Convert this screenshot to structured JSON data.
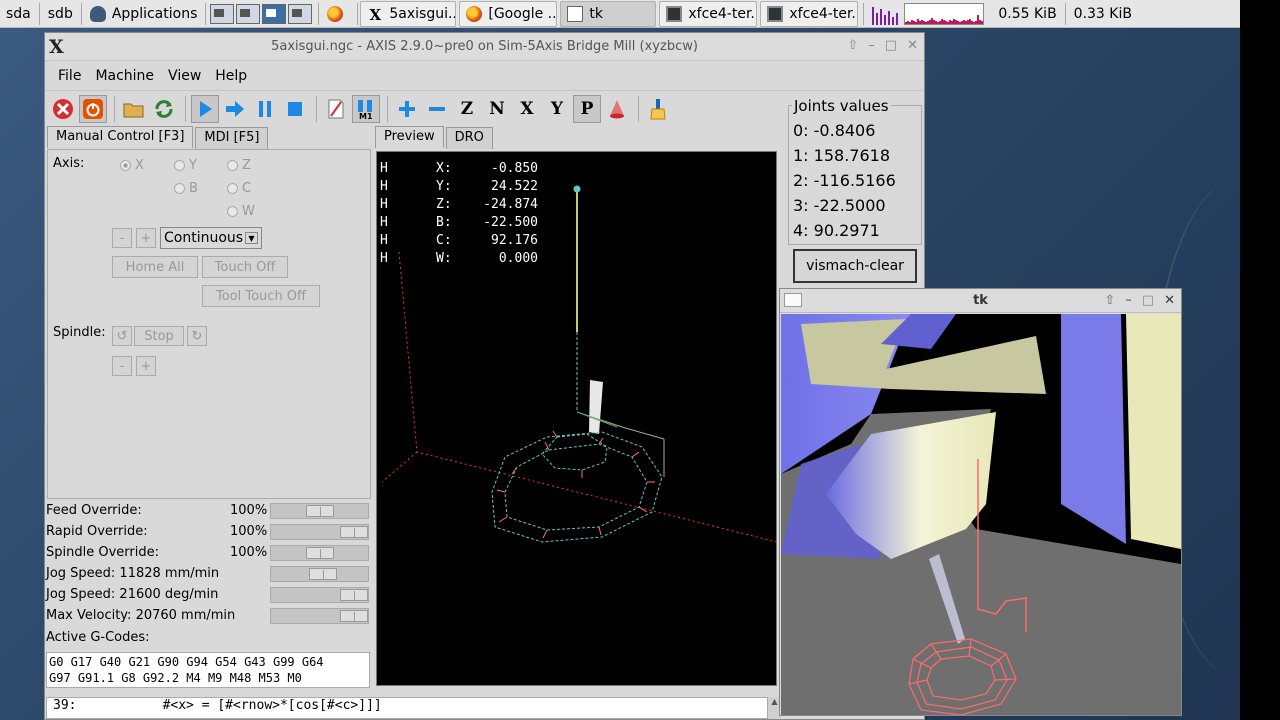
{
  "taskbar": {
    "drives": [
      "sda",
      "sdb"
    ],
    "apps_label": "Applications",
    "windows": [
      {
        "label": "5axisgui....",
        "icon": "x-icon"
      },
      {
        "label": "[Google ...",
        "icon": "firefox-icon"
      },
      {
        "label": "tk",
        "icon": "tk-icon"
      },
      {
        "label": "xfce4-ter...",
        "icon": "terminal-icon"
      },
      {
        "label": "xfce4-ter...",
        "icon": "terminal-icon"
      }
    ],
    "net_down": "0.55 KiB",
    "net_up": "0.33 KiB"
  },
  "axis": {
    "title": "5axisgui.ngc - AXIS 2.9.0~pre0 on Sim-5Axis Bridge Mill (xyzbcw)",
    "logo": "X",
    "menus": [
      "File",
      "Machine",
      "View",
      "Help"
    ],
    "tabs_left": [
      "Manual Control [F3]",
      "MDI [F5]"
    ],
    "tabs_right": [
      "Preview",
      "DRO"
    ],
    "axis_label": "Axis:",
    "axis_options": [
      "X",
      "Y",
      "Z",
      "B",
      "C",
      "W"
    ],
    "selected_axis": "X",
    "jog_minus": "-",
    "jog_plus": "+",
    "jog_mode": "Continuous",
    "home_all": "Home All",
    "touch_off": "Touch Off",
    "tool_touch_off": "Tool Touch Off",
    "spindle_label": "Spindle:",
    "spindle_stop": "Stop",
    "spindle_minus": "-",
    "spindle_plus": "+",
    "overrides": [
      {
        "name": "Feed Override:",
        "value": "100%",
        "slider": 0.5
      },
      {
        "name": "Rapid Override:",
        "value": "100%",
        "slider": 1.0
      },
      {
        "name": "Spindle Override:",
        "value": "100%",
        "slider": 0.5
      },
      {
        "name": "Jog Speed:  11828 mm/min",
        "value": "",
        "slider": 0.55
      },
      {
        "name": "Jog Speed:  21600 deg/min",
        "value": "",
        "slider": 1.0
      },
      {
        "name": "Max Velocity:  20760 mm/min",
        "value": "",
        "slider": 1.0
      }
    ],
    "active_gcodes_label": "Active G-Codes:",
    "active_gcodes": "G0 G17 G40 G21 G90 G94 G54 G43 G99 G64\nG97 G91.1 G8 G92.2 M4 M9 M48 M53 M0",
    "code_line": "39:           #<x> = [#<rnow>*[cos[#<c>]]]",
    "dro": [
      {
        "h": "H",
        "axis": "X:",
        "value": "-0.850"
      },
      {
        "h": "H",
        "axis": "Y:",
        "value": "24.522"
      },
      {
        "h": "H",
        "axis": "Z:",
        "value": "-24.874"
      },
      {
        "h": "H",
        "axis": "B:",
        "value": "-22.500"
      },
      {
        "h": "H",
        "axis": "C:",
        "value": "92.176"
      },
      {
        "h": "H",
        "axis": "W:",
        "value": "0.000"
      }
    ],
    "joints_title": "Joints values",
    "joints": [
      "0:  -0.8406",
      "1:  158.7618",
      "2:  -116.5166",
      "3:  -22.5000",
      "4:  90.2971"
    ],
    "vismach_button": "vismach-clear"
  },
  "tk": {
    "title": "tk"
  },
  "colors": {
    "preview_bg": "#000000",
    "toolpath": "#5fc9c9",
    "axis_red": "#ff3030",
    "estop_red": "#d32f2f",
    "machine_off_orange": "#e65100",
    "play_blue": "#1e88e5",
    "tool_yellow": "#c8c870"
  }
}
